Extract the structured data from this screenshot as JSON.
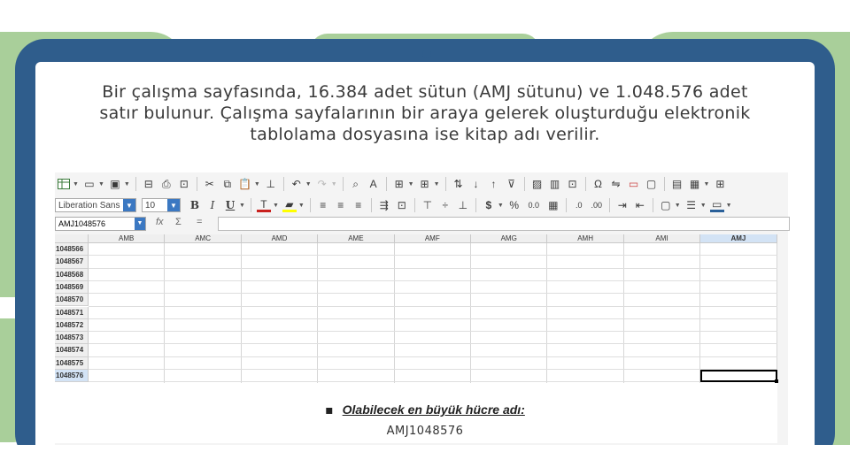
{
  "slide": {
    "intro_lines": [
      "Bir çalışma sayfasında, 16.384 adet sütun (AMJ sütunu) ve 1.048.576 adet",
      "satır bulunur. Çalışma sayfalarının bir araya gelerek oluşturduğu elektronik",
      "tablolama dosyasına ise kitap adı verilir."
    ],
    "bullet_marker": "▪",
    "bullet_text": "Olabilecek en büyük hücre adı:",
    "answer": "AMJ1048576"
  },
  "calc": {
    "font_name": "Liberation Sans",
    "font_size": "10",
    "name_box": "AMJ1048576",
    "formula_icons": [
      "fx-icon",
      "sum-icon",
      "equals-icon"
    ],
    "column_headers": [
      "AMB",
      "AMC",
      "AMD",
      "AME",
      "AMF",
      "AMG",
      "AMH",
      "AMI",
      "AMJ"
    ],
    "selected_column": "AMJ",
    "row_headers": [
      "1048566",
      "1048567",
      "1048568",
      "1048569",
      "1048570",
      "1048571",
      "1048572",
      "1048573",
      "1048574",
      "1048575",
      "1048576"
    ],
    "selected_row": "1048576",
    "toolbar_row1_icons": [
      "table-icon",
      "open-icon",
      "save-icon",
      "export-pdf-icon",
      "print-icon",
      "print-preview-icon",
      "cut-icon",
      "copy-icon",
      "paste-icon",
      "clone-format-icon",
      "undo-icon",
      "redo-icon",
      "find-icon",
      "spelling-icon",
      "row-icon",
      "column-icon",
      "sort-icon",
      "sort-asc-icon",
      "sort-desc-icon",
      "autofilter-icon",
      "image-icon",
      "chart-icon",
      "pivot-icon",
      "special-char-icon",
      "hyperlink-icon",
      "comment-icon",
      "header-footer-icon",
      "define-print-area-icon",
      "freeze-icon",
      "split-icon"
    ],
    "toolbar_row2_icons": [
      "bold-icon",
      "italic-icon",
      "underline-icon",
      "font-color-icon",
      "highlight-icon",
      "align-left-icon",
      "align-center-icon",
      "align-right-icon",
      "wrap-icon",
      "merge-icon",
      "align-top-icon",
      "align-middle-icon",
      "align-bottom-icon",
      "currency-icon",
      "percent-icon",
      "number-icon",
      "date-icon",
      "add-decimal-icon",
      "delete-decimal-icon",
      "increase-indent-icon",
      "decrease-indent-icon",
      "borders-icon",
      "border-style-icon",
      "border-color-icon"
    ],
    "glyphs": {
      "bold": "B",
      "italic": "I",
      "underline": "U",
      "currency": "$",
      "percent": "%",
      "number": "0.0",
      "fx": "fx",
      "sum": "Σ",
      "equals": "="
    }
  },
  "colors": {
    "tablet": "#2f5d8c",
    "background_shapes": "#a9cf9a",
    "selection": "#d3e3f5"
  }
}
